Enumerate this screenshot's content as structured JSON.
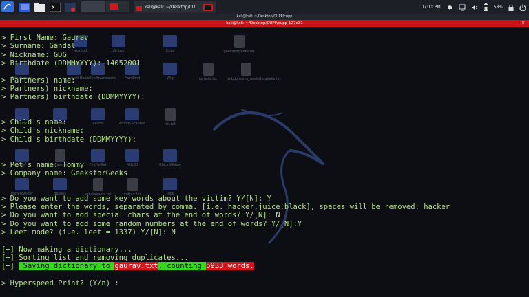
{
  "panel": {
    "task_terminal_label": "kali@kali: ~/Desktop/CU...",
    "clock": "07:10 PM",
    "battery": "58%"
  },
  "window": {
    "outer_title": "kali@kali: ~/Desktop/CUPP/cupp",
    "inner_title": "kali@kali: ~/Desktop/CUPP/cupp 127x31"
  },
  "desktop_icons": [
    {
      "label": "wuybulk",
      "kind": "folder"
    },
    {
      "label": "dirfuzz",
      "kind": "folder"
    },
    {
      "label": "Crips",
      "kind": "folder"
    },
    {
      "label": "geeksforgeeks.txt",
      "kind": "file"
    },
    {
      "label": "File System",
      "kind": "folder"
    },
    {
      "label": "wapiti",
      "kind": "folder"
    },
    {
      "label": "BlackEye Framework",
      "kind": "folder"
    },
    {
      "label": "PwnBlind",
      "kind": "folder"
    },
    {
      "label": "Wig",
      "kind": "folder"
    },
    {
      "label": "targets.txt",
      "kind": "file"
    },
    {
      "label": "subdomains_geeksforgeeks.txt",
      "kind": "file"
    },
    {
      "label": "Home",
      "kind": "folder"
    },
    {
      "label": "Bolder",
      "kind": "folder"
    },
    {
      "label": "nasbo",
      "kind": "folder"
    },
    {
      "label": "Admin-Scanner",
      "kind": "folder"
    },
    {
      "label": "list.txt",
      "kind": "file"
    },
    {
      "label": "ouy",
      "kind": "folder"
    },
    {
      "label": "emails.txt",
      "kind": "file"
    },
    {
      "label": "TheFatRat",
      "kind": "folder"
    },
    {
      "label": "NUUBI",
      "kind": "folder"
    },
    {
      "label": "Black-Widow",
      "kind": "folder"
    },
    {
      "label": "ParamSpider",
      "kind": "folder"
    },
    {
      "label": "Bashes",
      "kind": "folder"
    },
    {
      "label": "subdomains.txt",
      "kind": "file"
    },
    {
      "label": "output.txt",
      "kind": "file"
    },
    {
      "label": "Tobe",
      "kind": "folder"
    }
  ],
  "terminal": {
    "lines": [
      "> First Name: Gaurav",
      "> Surname: Gandal",
      "> Nickname: GDG",
      "> Birthdate (DDMMYYYY): 14052001",
      "",
      "> Partners) name:",
      "> Partners) nickname:",
      "> Partners) birthdate (DDMMYYYY):",
      "",
      "",
      "> Child's name:",
      "> Child's nickname:",
      "> Child's birthdate (DDMMYYYY):",
      "",
      "",
      "> Pet's name: Tommy",
      "> Company name: GeeksforGeeks",
      "",
      "",
      "> Do you want to add some key words about the victim? Y/[N]: Y",
      "> Please enter the words, separated by comma. [i.e. hacker,juice,black], spaces will be removed: hacker",
      "> Do you want to add special chars at the end of words? Y/[N]: N",
      "> Do you want to add some random numbers at the end of words? Y/[N]:Y",
      "> Leet mode? (i.e. leet = 1337) Y/[N]: N",
      "",
      "[+] Now making a dictionary...",
      "[+] Sorting list and removing duplicates...",
      "",
      "> Hyperspeed Print? (Y/n) :"
    ],
    "saving": {
      "prefix": "[+] ",
      "part1": " Saving dictionary to ",
      "file": "gaurav.txt",
      "part2": ", counting ",
      "count": "5933 words."
    }
  },
  "colors": {
    "terminal_text": "#b6e08a",
    "title_red": "#c81418",
    "highlight_green": "#36d81f",
    "highlight_red": "#d2161c"
  }
}
